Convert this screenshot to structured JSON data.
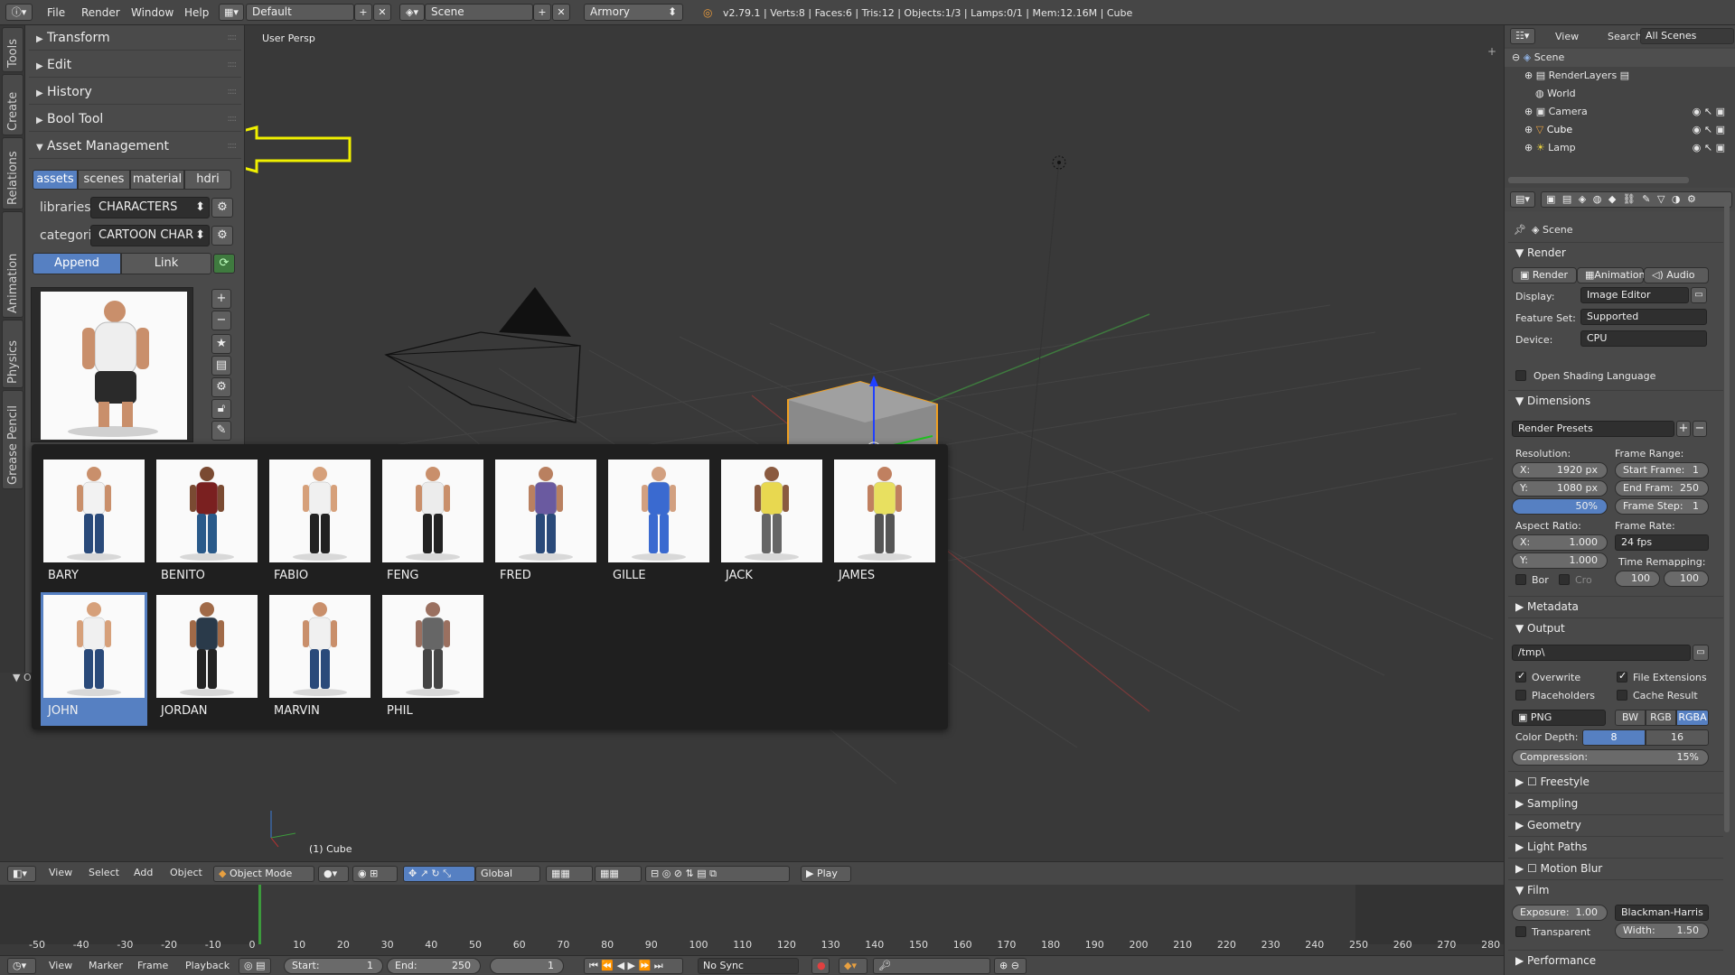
{
  "topbar": {
    "menus": [
      "File",
      "Render",
      "Window",
      "Help"
    ],
    "layout": "Default",
    "scene": "Scene",
    "engine": "Armory",
    "stats": "v2.79.1 | Verts:8 | Faces:6 | Tris:12 | Objects:1/3 | Lamps:0/1 | Mem:12.16M | Cube"
  },
  "side_tabs": [
    "Tools",
    "Create",
    "Relations",
    "Animation",
    "Physics",
    "Grease Pencil"
  ],
  "tool_sections": [
    "Transform",
    "Edit",
    "History",
    "Bool Tool",
    "Asset Management"
  ],
  "asset_tabs": [
    "assets",
    "scenes",
    "material",
    "hdri"
  ],
  "libraries_label": "libraries:",
  "libraries_value": "CHARACTERS",
  "category_label": "categori",
  "category_value": "CARTOON CHAR",
  "append_label": "Append",
  "link_label": "Link",
  "collapsed_panel_label": "Op",
  "viewport": {
    "view_name": "User Persp",
    "object_label": "(1) Cube"
  },
  "popup_items": [
    {
      "name": "BARY",
      "active": false
    },
    {
      "name": "BENITO",
      "active": false
    },
    {
      "name": "FABIO",
      "active": false
    },
    {
      "name": "FENG",
      "active": false
    },
    {
      "name": "FRED",
      "active": false
    },
    {
      "name": "GILLE",
      "active": false
    },
    {
      "name": "JACK",
      "active": false
    },
    {
      "name": "JAMES",
      "active": false
    },
    {
      "name": "JOHN",
      "active": true
    },
    {
      "name": "JORDAN",
      "active": false
    },
    {
      "name": "MARVIN",
      "active": false
    },
    {
      "name": "PHIL",
      "active": false
    }
  ],
  "view_header": {
    "menus": [
      "View",
      "Select",
      "Add",
      "Object"
    ],
    "mode": "Object Mode",
    "orientation": "Global",
    "play": "Play"
  },
  "timeline": {
    "ticks": [
      "-50",
      "-40",
      "-30",
      "-20",
      "-10",
      "0",
      "10",
      "20",
      "30",
      "40",
      "50",
      "60",
      "70",
      "80",
      "90",
      "100",
      "110",
      "120",
      "130",
      "140",
      "150",
      "160",
      "170",
      "180",
      "190",
      "200",
      "210",
      "220",
      "230",
      "240",
      "250",
      "260",
      "270",
      "280"
    ],
    "menus": [
      "View",
      "Marker",
      "Frame",
      "Playback"
    ],
    "start_label": "Start:",
    "start": "1",
    "end_label": "End:",
    "end": "250",
    "current": "1",
    "sync": "No Sync"
  },
  "outliner": {
    "menus": [
      "View",
      "Search"
    ],
    "filter": "All Scenes",
    "items": [
      "Scene",
      "RenderLayers",
      "World",
      "Camera",
      "Cube",
      "Lamp"
    ]
  },
  "properties": {
    "context": "Scene",
    "render_title": "Render",
    "render_buttons": [
      "Render",
      "Animation",
      "Audio"
    ],
    "display_label": "Display:",
    "display": "Image Editor",
    "feature_set_label": "Feature Set:",
    "feature_set": "Supported",
    "device_label": "Device:",
    "device": "CPU",
    "osl": "Open Shading Language",
    "dimensions_title": "Dimensions",
    "render_presets": "Render Presets",
    "resolution_label": "Resolution:",
    "res_x": "1920 px",
    "res_y": "1080 px",
    "res_pct": "50%",
    "frame_range_label": "Frame Range:",
    "start_frame": "Start Frame:",
    "start_frame_val": "1",
    "end_frame": "End Fram:",
    "end_frame_val": "250",
    "frame_step": "Frame Step:",
    "frame_step_val": "1",
    "aspect_label": "Aspect Ratio:",
    "aspect_x": "1.000",
    "aspect_y": "1.000",
    "frame_rate_label": "Frame Rate:",
    "frame_rate": "24 fps",
    "time_remap_label": "Time Remapping:",
    "time_old": "100",
    "time_new": "100",
    "bor": "Bor",
    "cro": "Cro",
    "metadata_title": "Metadata",
    "output_title": "Output",
    "output_path": "/tmp\\",
    "overwrite": "Overwrite",
    "file_ext": "File Extensions",
    "placeholders": "Placeholders",
    "cache_result": "Cache Result",
    "format": "PNG",
    "color_modes": [
      "BW",
      "RGB",
      "RGBA"
    ],
    "color_depth_label": "Color Depth:",
    "depths": [
      "8",
      "16"
    ],
    "compression_label": "Compression:",
    "compression": "15%",
    "collapsed": [
      "Freestyle",
      "Sampling",
      "Geometry",
      "Light Paths",
      "Motion Blur"
    ],
    "film_title": "Film",
    "exposure_label": "Exposure:",
    "exposure": "1.00",
    "filter": "Blackman-Harris",
    "transparent": "Transparent",
    "width_label": "Width:",
    "width": "1.50",
    "performance_title": "Performance"
  },
  "colors": {
    "accent": "#5680c2",
    "arrow": "#f0f000",
    "selected_outline": "#f0a020"
  }
}
